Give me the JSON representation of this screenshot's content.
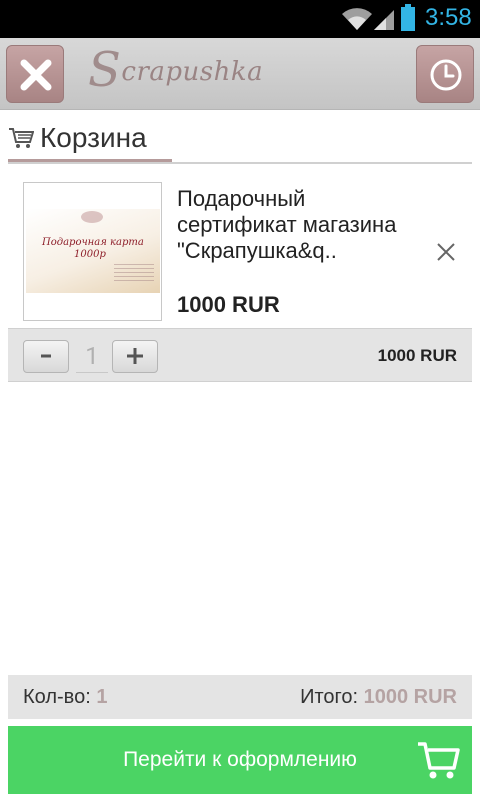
{
  "status_bar": {
    "time": "3:58"
  },
  "app": {
    "logo_text": "Scrapushka",
    "logo_initial": "S",
    "logo_rest": "crapushka"
  },
  "page": {
    "title": "Корзина"
  },
  "cart": {
    "items": [
      {
        "name": "Подарочный сертификат магазина \"Скрапушка&q..",
        "price": "1000 RUR",
        "quantity": "1",
        "line_total": "1000 RUR",
        "image": {
          "card_text_1": "Подарочная карта",
          "card_text_2": "1000р"
        }
      }
    ]
  },
  "summary": {
    "count_label": "Кол-во:",
    "count_value": "1",
    "total_label": "Итого:",
    "total_value": "1000 RUR"
  },
  "checkout": {
    "label": "Перейти к оформлению"
  },
  "colors": {
    "accent": "#a88484",
    "checkout_green": "#4bd464",
    "status_blue": "#33b5e5"
  }
}
